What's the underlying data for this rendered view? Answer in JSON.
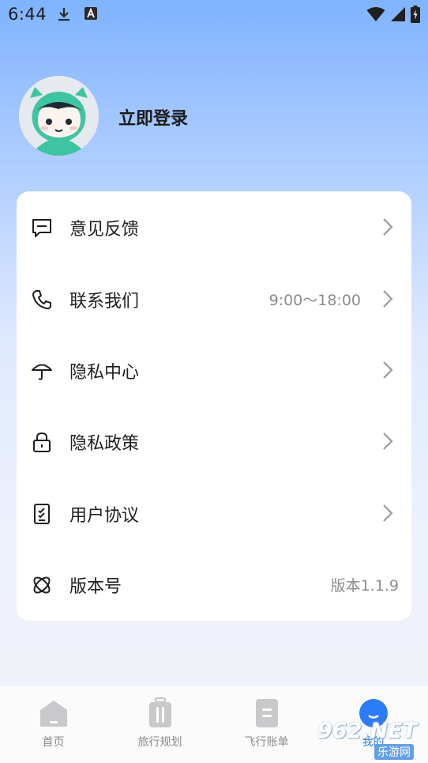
{
  "status_bar": {
    "time": "6:44",
    "icons_left": [
      "download-icon",
      "font-a-icon"
    ],
    "icons_right": [
      "wifi-icon",
      "signal-icon",
      "battery-charging-icon"
    ]
  },
  "profile": {
    "login_label": "立即登录",
    "avatar": "cartoon-avatar"
  },
  "menu": [
    {
      "label": "意见反馈",
      "value": "",
      "icon": "feedback-icon",
      "chevron": true
    },
    {
      "label": "联系我们",
      "value": "9:00～18:00",
      "icon": "phone-icon",
      "chevron": true
    },
    {
      "label": "隐私中心",
      "value": "",
      "icon": "umbrella-icon",
      "chevron": true
    },
    {
      "label": "隐私政策",
      "value": "",
      "icon": "lock-icon",
      "chevron": true
    },
    {
      "label": "用户协议",
      "value": "",
      "icon": "agreement-icon",
      "chevron": true
    },
    {
      "label": "版本号",
      "value": "版本1.1.9",
      "icon": "version-icon",
      "chevron": false
    }
  ],
  "tabs": [
    {
      "label": "首页",
      "icon": "home-icon",
      "active": false
    },
    {
      "label": "旅行规划",
      "icon": "luggage-icon",
      "active": false
    },
    {
      "label": "飞行账单",
      "icon": "bill-icon",
      "active": false
    },
    {
      "label": "我的",
      "icon": "profile-icon",
      "active": true
    }
  ],
  "watermark": {
    "brand": "962.NET",
    "site": "乐游网"
  },
  "colors": {
    "accent": "#2b7cf6",
    "gradient_top": "#7fb3ff",
    "background": "#f1f3f8",
    "card": "#ffffff",
    "tab_inactive": "#c7c7c9",
    "text_secondary": "#8d8d8d"
  }
}
